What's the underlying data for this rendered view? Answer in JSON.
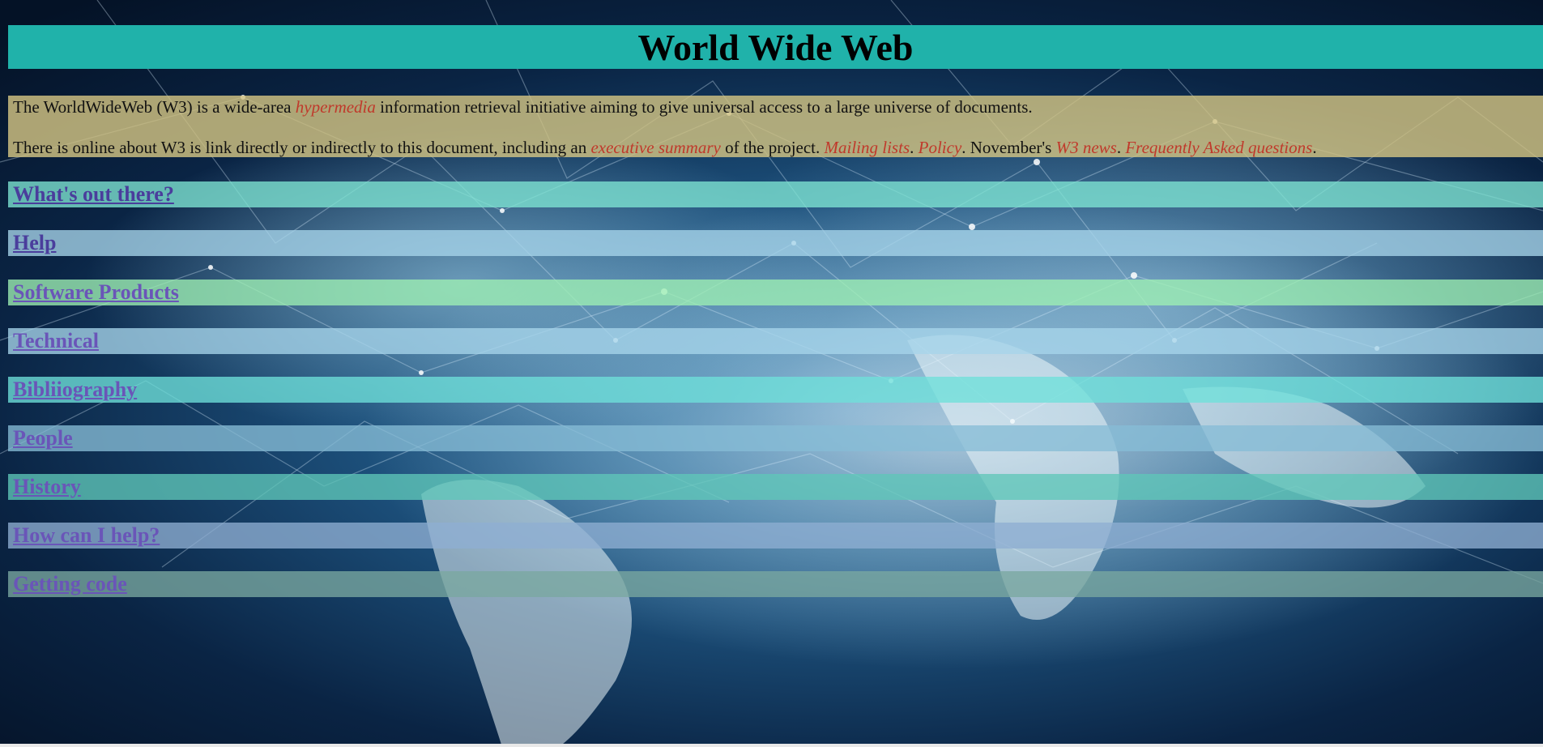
{
  "header": {
    "title": "World Wide Web"
  },
  "intro": {
    "p1_before": "The WorldWideWeb (W3) is a wide-area ",
    "p1_link": "hypermedia",
    "p1_after": " information retrieval initiative aiming to give universal access to a large universe of documents.",
    "p2_before": "There is online about W3 is link directly or indirectly to this document, including an ",
    "p2_link_summary": "executive summary",
    "p2_mid": " of the project. ",
    "p2_link_mailing": "Mailing lists",
    "p2_sep1": ". ",
    "p2_link_policy": "Policy",
    "p2_sep2": ". November's ",
    "p2_link_news": "W3 news",
    "p2_sep3": ". ",
    "p2_link_faq": "Frequently Asked questions",
    "p2_end": "."
  },
  "nav": {
    "items": [
      {
        "label": "What's out there?",
        "color": "#7fe6d4"
      },
      {
        "label": "Help",
        "color": "#a6d5ea"
      },
      {
        "label": "Software Products",
        "color": "#9ef0b4"
      },
      {
        "label": "Technical",
        "color": "#a6d5ea"
      },
      {
        "label": "Bibliiography",
        "color": "#6ee0da"
      },
      {
        "label": "People",
        "color": "#86bcd6"
      },
      {
        "label": "History",
        "color": "#5fc7b8"
      },
      {
        "label": "How can I help?",
        "color": "#8eaed2"
      },
      {
        "label": "Getting code",
        "color": "#7aa8a0"
      }
    ]
  },
  "colors": {
    "title_bar": "#20b2aa",
    "intro_bg": "#d2c382",
    "link_red": "#c0392b",
    "nav_link": "#4a3d9c"
  }
}
